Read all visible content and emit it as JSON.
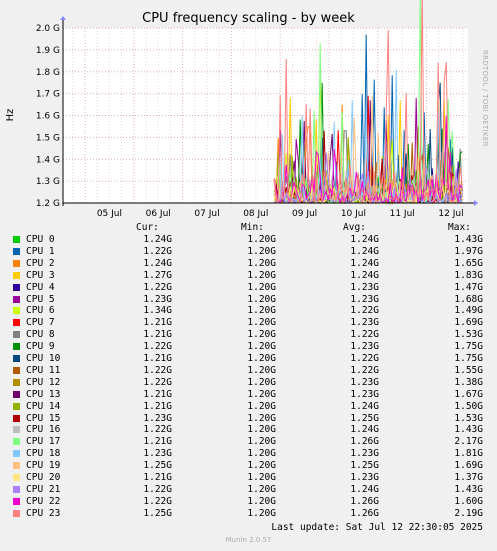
{
  "title": "CPU frequency scaling - by week",
  "side_label": "RRDTOOL / TOBI OETIKER",
  "footer": {
    "last_update": "Last update: Sat Jul 12 22:30:05 2025",
    "munin": "Munin 2.0.57"
  },
  "legend_headers": {
    "cur": "Cur:",
    "min": "Min:",
    "avg": "Avg:",
    "max": "Max:"
  },
  "chart_data": {
    "type": "line",
    "title": "CPU frequency scaling - by week",
    "ylabel": "Hz",
    "ylim": [
      1.2,
      2.0
    ],
    "y_ticks": [
      "1.2 G",
      "1.3 G",
      "1.4 G",
      "1.5 G",
      "1.6 G",
      "1.7 G",
      "1.8 G",
      "1.9 G",
      "2.0 G"
    ],
    "x_ticks": [
      "05 Jul",
      "06 Jul",
      "07 Jul",
      "08 Jul",
      "09 Jul",
      "10 Jul",
      "11 Jul",
      "12 Jul"
    ],
    "data_start_day": "09 Jul",
    "grid": true,
    "series": [
      {
        "name": "CPU 0",
        "color": "#00cc00",
        "cur": "1.24G",
        "min": "1.20G",
        "avg": "1.24G",
        "max": "1.43G"
      },
      {
        "name": "CPU 1",
        "color": "#0066b3",
        "cur": "1.22G",
        "min": "1.20G",
        "avg": "1.24G",
        "max": "1.97G"
      },
      {
        "name": "CPU 2",
        "color": "#ff8000",
        "cur": "1.24G",
        "min": "1.20G",
        "avg": "1.24G",
        "max": "1.65G"
      },
      {
        "name": "CPU 3",
        "color": "#ffcc00",
        "cur": "1.27G",
        "min": "1.20G",
        "avg": "1.24G",
        "max": "1.83G"
      },
      {
        "name": "CPU 4",
        "color": "#330099",
        "cur": "1.22G",
        "min": "1.20G",
        "avg": "1.23G",
        "max": "1.47G"
      },
      {
        "name": "CPU 5",
        "color": "#990099",
        "cur": "1.23G",
        "min": "1.20G",
        "avg": "1.23G",
        "max": "1.68G"
      },
      {
        "name": "CPU 6",
        "color": "#ccff00",
        "cur": "1.34G",
        "min": "1.20G",
        "avg": "1.22G",
        "max": "1.49G"
      },
      {
        "name": "CPU 7",
        "color": "#ff0000",
        "cur": "1.21G",
        "min": "1.20G",
        "avg": "1.23G",
        "max": "1.69G"
      },
      {
        "name": "CPU 8",
        "color": "#808080",
        "cur": "1.21G",
        "min": "1.20G",
        "avg": "1.22G",
        "max": "1.53G"
      },
      {
        "name": "CPU 9",
        "color": "#008f00",
        "cur": "1.22G",
        "min": "1.20G",
        "avg": "1.23G",
        "max": "1.75G"
      },
      {
        "name": "CPU 10",
        "color": "#00487d",
        "cur": "1.21G",
        "min": "1.20G",
        "avg": "1.22G",
        "max": "1.75G"
      },
      {
        "name": "CPU 11",
        "color": "#b35a00",
        "cur": "1.22G",
        "min": "1.20G",
        "avg": "1.22G",
        "max": "1.55G"
      },
      {
        "name": "CPU 12",
        "color": "#b38f00",
        "cur": "1.22G",
        "min": "1.20G",
        "avg": "1.23G",
        "max": "1.38G"
      },
      {
        "name": "CPU 13",
        "color": "#6b006b",
        "cur": "1.21G",
        "min": "1.20G",
        "avg": "1.23G",
        "max": "1.67G"
      },
      {
        "name": "CPU 14",
        "color": "#8fb300",
        "cur": "1.21G",
        "min": "1.20G",
        "avg": "1.24G",
        "max": "1.50G"
      },
      {
        "name": "CPU 15",
        "color": "#b30000",
        "cur": "1.23G",
        "min": "1.20G",
        "avg": "1.25G",
        "max": "1.53G"
      },
      {
        "name": "CPU 16",
        "color": "#bebebe",
        "cur": "1.22G",
        "min": "1.20G",
        "avg": "1.24G",
        "max": "1.43G"
      },
      {
        "name": "CPU 17",
        "color": "#80ff80",
        "cur": "1.21G",
        "min": "1.20G",
        "avg": "1.26G",
        "max": "2.17G"
      },
      {
        "name": "CPU 18",
        "color": "#80c9ff",
        "cur": "1.23G",
        "min": "1.20G",
        "avg": "1.23G",
        "max": "1.81G"
      },
      {
        "name": "CPU 19",
        "color": "#ffc080",
        "cur": "1.25G",
        "min": "1.20G",
        "avg": "1.25G",
        "max": "1.69G"
      },
      {
        "name": "CPU 20",
        "color": "#ffe680",
        "cur": "1.21G",
        "min": "1.20G",
        "avg": "1.23G",
        "max": "1.37G"
      },
      {
        "name": "CPU 21",
        "color": "#aa80ff",
        "cur": "1.22G",
        "min": "1.20G",
        "avg": "1.24G",
        "max": "1.43G"
      },
      {
        "name": "CPU 22",
        "color": "#ee00cc",
        "cur": "1.22G",
        "min": "1.20G",
        "avg": "1.26G",
        "max": "1.60G"
      },
      {
        "name": "CPU 23",
        "color": "#ff8080",
        "cur": "1.25G",
        "min": "1.20G",
        "avg": "1.26G",
        "max": "2.19G"
      }
    ]
  }
}
